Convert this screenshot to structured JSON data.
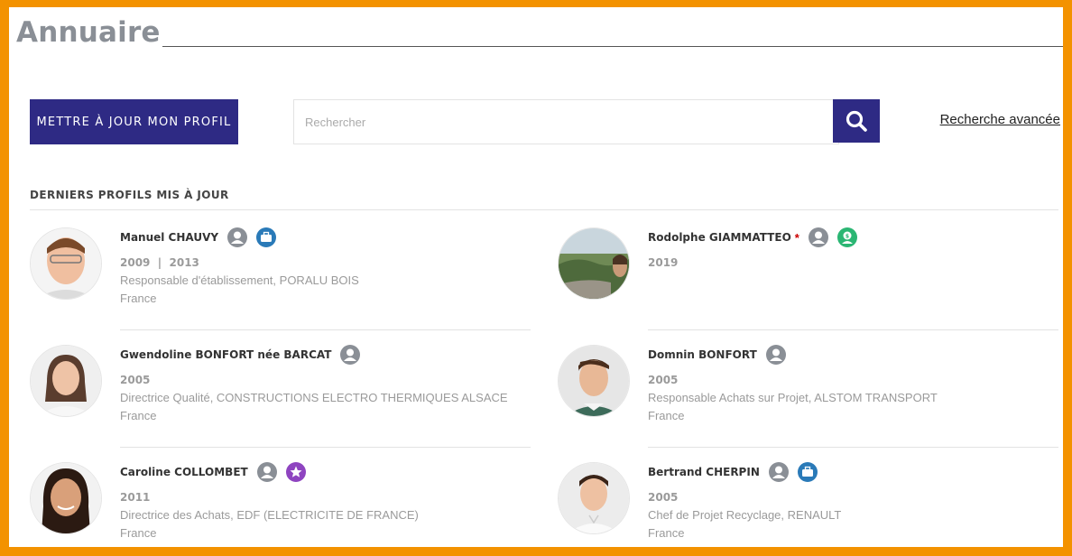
{
  "page_title": "Annuaire",
  "update_profile_label": "METTRE À JOUR MON PROFIL",
  "search": {
    "placeholder": "Rechercher"
  },
  "advanced_search_label": "Recherche avancée",
  "section_title": "DERNIERS PROFILS MIS À JOUR",
  "colors": {
    "frame": "#f39200",
    "primary": "#2e2a84",
    "badge_blue": "#2a7ab8",
    "badge_green": "#2bb673",
    "badge_purple": "#8e44c0",
    "badge_grey": "#8a8f96"
  },
  "profiles": [
    {
      "name": "Manuel CHAUVY",
      "star": "",
      "badges": [
        "person-icon",
        "briefcase-icon"
      ],
      "years": "2009  |  2013",
      "job": "Responsable d'établissement, PORALU BOIS",
      "country": "France"
    },
    {
      "name": "Rodolphe GIAMMATTEO",
      "star": "*",
      "badges": [
        "person-icon",
        "money-icon"
      ],
      "years": "2019",
      "job": "",
      "country": ""
    },
    {
      "name": "Gwendoline BONFORT née BARCAT",
      "star": "",
      "badges": [
        "person-icon"
      ],
      "years": "2005",
      "job": "Directrice Qualité, CONSTRUCTIONS ELECTRO THERMIQUES ALSACE",
      "country": "France"
    },
    {
      "name": "Domnin BONFORT",
      "star": "",
      "badges": [
        "person-icon"
      ],
      "years": "2005",
      "job": "Responsable Achats sur Projet, ALSTOM TRANSPORT",
      "country": "France"
    },
    {
      "name": "Caroline COLLOMBET",
      "star": "",
      "badges": [
        "person-icon",
        "star-icon"
      ],
      "years": "2011",
      "job": "Directrice des Achats, EDF (ELECTRICITE DE FRANCE)",
      "country": "France"
    },
    {
      "name": "Bertrand CHERPIN",
      "star": "",
      "badges": [
        "person-icon",
        "briefcase-icon"
      ],
      "years": "2005",
      "job": "Chef de Projet Recyclage, RENAULT",
      "country": "France"
    }
  ]
}
